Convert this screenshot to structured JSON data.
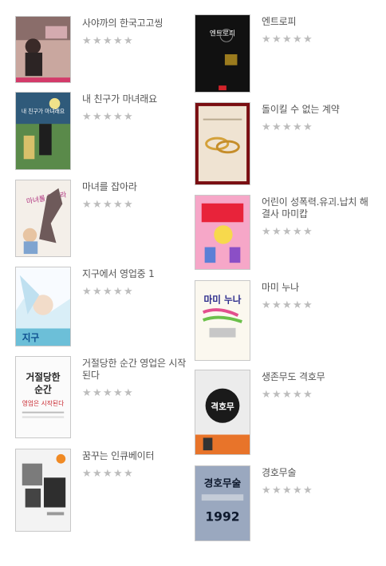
{
  "colors": {
    "text": "#555555",
    "star_empty": "#bdbdbd",
    "border": "#c8c8c8"
  },
  "left_column": [
    {
      "title": "사야까의 한국고고씽",
      "rating": 0,
      "cover": "cover-1"
    },
    {
      "title": "내 친구가 마녀래요",
      "rating": 0,
      "cover": "cover-2"
    },
    {
      "title": "마녀를 잡아라",
      "rating": 0,
      "cover": "cover-3"
    },
    {
      "title": "지구에서 영업중 1",
      "rating": 0,
      "cover": "cover-4"
    },
    {
      "title": "거절당한 순간 영업은 시작된다",
      "rating": 0,
      "cover": "cover-5"
    },
    {
      "title": "꿈꾸는 인큐베이터",
      "rating": 0,
      "cover": "cover-6"
    }
  ],
  "right_column": [
    {
      "title": "엔트로피",
      "rating": 0,
      "cover": "cover-7"
    },
    {
      "title": "돌이킬 수 없는 계약",
      "rating": 0,
      "cover": "cover-8"
    },
    {
      "title": "어린이 성폭력.유괴.납치 해결사 마미캅",
      "rating": 0,
      "cover": "cover-9"
    },
    {
      "title": "마미 누나",
      "rating": 0,
      "cover": "cover-10"
    },
    {
      "title": "생존무도 격호무",
      "rating": 0,
      "cover": "cover-11"
    },
    {
      "title": "경호무술",
      "rating": 0,
      "cover": "cover-12"
    }
  ],
  "cover_text": {
    "c2": "내 친구가 마녀래요",
    "c3": "마녀를 잡아라",
    "c5a": "거절당한",
    "c5b": "순간",
    "c5c": "영업은 시작된다",
    "c7": "엔트로피",
    "c10": "마미 누나",
    "c11": "격호무",
    "c12a": "경호무술",
    "c12b": "1992"
  }
}
